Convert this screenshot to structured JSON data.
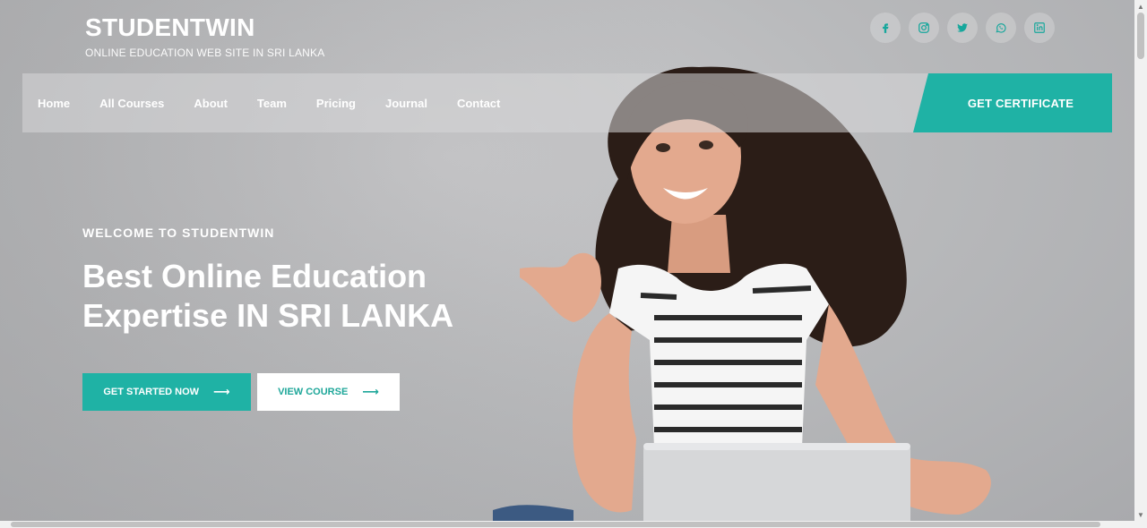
{
  "brand": {
    "title": "STUDENTWIN",
    "subtitle": "ONLINE EDUCATION WEB SITE IN SRI LANKA"
  },
  "socials": [
    {
      "icon": "facebook-icon"
    },
    {
      "icon": "instagram-icon"
    },
    {
      "icon": "twitter-icon"
    },
    {
      "icon": "whatsapp-icon"
    },
    {
      "icon": "linkedin-icon"
    }
  ],
  "nav": {
    "items": [
      "Home",
      "All Courses",
      "About",
      "Team",
      "Pricing",
      "Journal",
      "Contact"
    ],
    "cta": "GET CERTIFICATE"
  },
  "hero": {
    "welcome": "WELCOME TO STUDENTWIN",
    "headline": "Best Online Education Expertise IN SRI LANKA",
    "primary_button": "GET STARTED NOW",
    "secondary_button": "VIEW COURSE",
    "arrow": "⟶"
  },
  "colors": {
    "accent": "#1fb2a5",
    "text_light": "#ffffff"
  }
}
